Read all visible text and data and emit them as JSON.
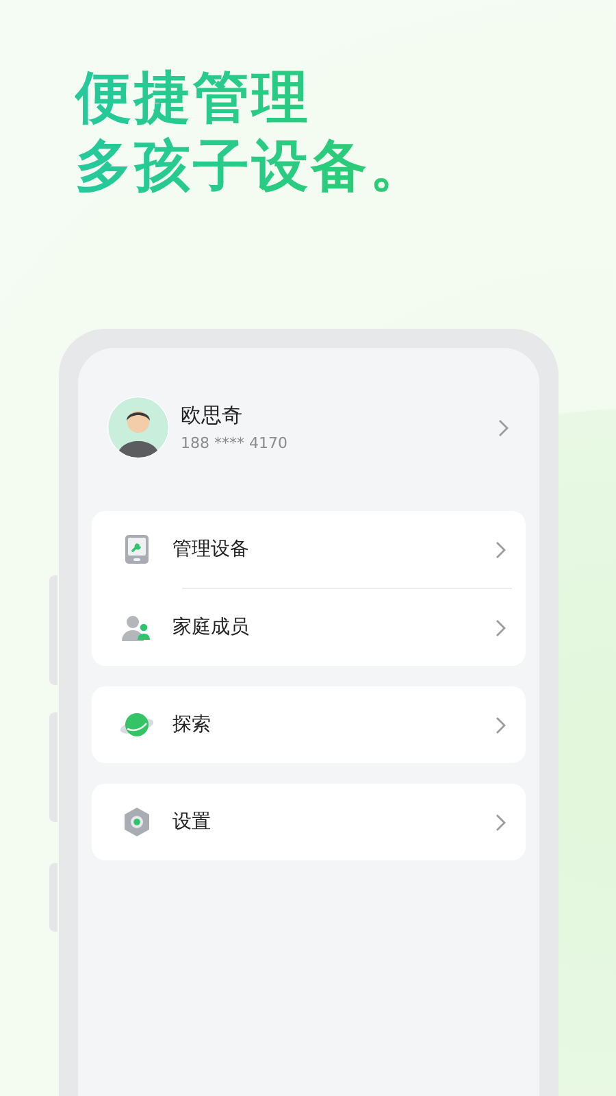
{
  "headline": [
    "便捷管理",
    "多孩子设备。"
  ],
  "profile": {
    "name": "欧思奇",
    "phone": "188 **** 4170"
  },
  "menu_groups": [
    {
      "items": [
        {
          "label": "管理设备"
        },
        {
          "label": "家庭成员"
        }
      ]
    },
    {
      "items": [
        {
          "label": "探索"
        }
      ]
    },
    {
      "items": [
        {
          "label": "设置"
        }
      ]
    }
  ]
}
